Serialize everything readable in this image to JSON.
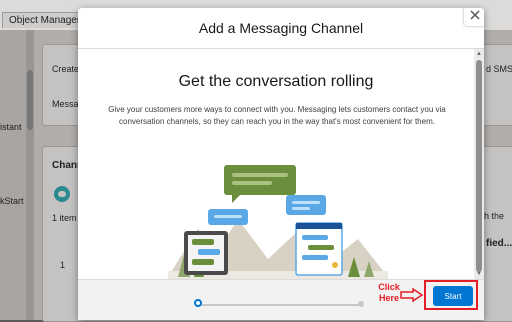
{
  "background_app": {
    "tab_label": "Object Manager",
    "create_text": "Create",
    "message_text": "Messag",
    "sms_text": "d SMS te",
    "assistant_text": "istant",
    "quickstart_text": "kStart",
    "channels_heading": "Chann",
    "item_count": "1 item",
    "search_text": "h the",
    "verified_text": "fied...",
    "row_number": "1"
  },
  "modal": {
    "title": "Add a Messaging Channel",
    "heading": "Get the conversation rolling",
    "description": "Give your customers more ways to connect with you. Messaging lets customers contact you via conversation channels, so they can reach you in the way that's most convenient for them.",
    "start_button_label": "Start",
    "annotation_text": "Click Here",
    "progress_step": 1,
    "progress_total": 2
  },
  "colors": {
    "brand_blue": "#0176d3",
    "annotation_red": "#e41e26",
    "bubble_green": "#6b8e3d",
    "bubble_blue": "#5aa9e6"
  }
}
